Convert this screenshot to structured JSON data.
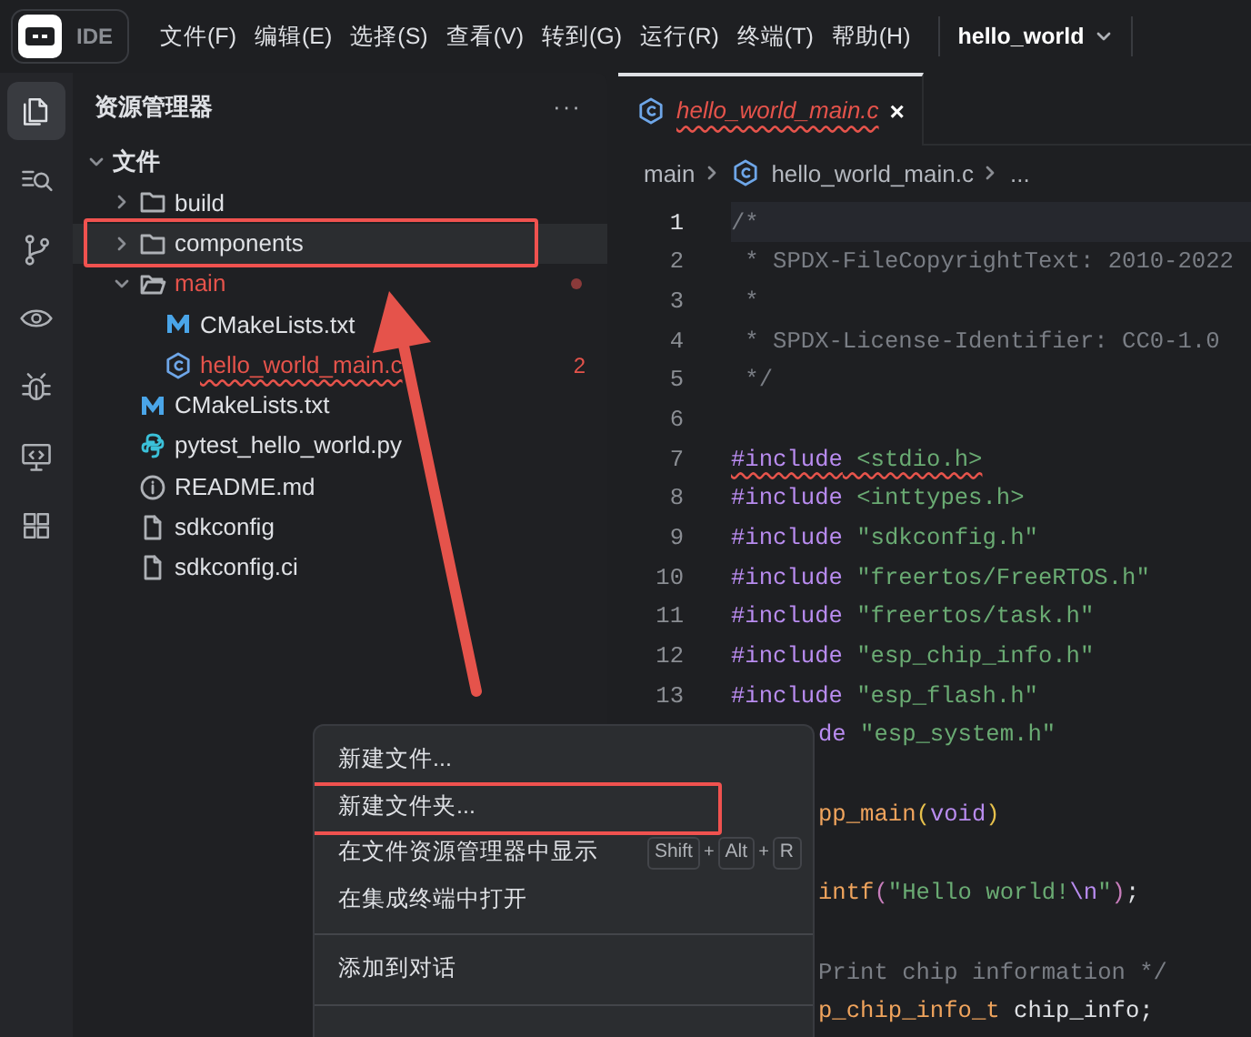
{
  "app": {
    "logo": "IDE",
    "menus": [
      "文件(F)",
      "编辑(E)",
      "选择(S)",
      "查看(V)",
      "转到(G)",
      "运行(R)",
      "终端(T)",
      "帮助(H)"
    ],
    "project": "hello_world"
  },
  "activity_bar": [
    {
      "kind": "files",
      "selected": true
    },
    {
      "kind": "search",
      "selected": false
    },
    {
      "kind": "branch",
      "selected": false
    },
    {
      "kind": "eye",
      "selected": false
    },
    {
      "kind": "bug",
      "selected": false
    },
    {
      "kind": "monitor",
      "selected": false
    },
    {
      "kind": "grid",
      "selected": false
    }
  ],
  "explorer": {
    "title": "资源管理器",
    "more": "···",
    "root": {
      "label": "文件",
      "expanded": true,
      "children": [
        {
          "label": "build",
          "kind": "folder",
          "expanded": false,
          "problem": false,
          "highlighted": false
        },
        {
          "label": "components",
          "kind": "folder",
          "expanded": false,
          "problem": false,
          "highlighted": true
        },
        {
          "label": "main",
          "kind": "folder",
          "expanded": true,
          "problem": true,
          "highlighted": false,
          "children": [
            {
              "label": "CMakeLists.txt",
              "kind": "cmake",
              "problem": false,
              "highlighted": false
            },
            {
              "label": "hello_world_main.c",
              "kind": "c",
              "problem": true,
              "problem_count": "2",
              "highlighted": false
            }
          ]
        },
        {
          "label": "CMakeLists.txt",
          "kind": "cmake",
          "problem": false,
          "highlighted": false
        },
        {
          "label": "pytest_hello_world.py",
          "kind": "python",
          "problem": false,
          "highlighted": false
        },
        {
          "label": "README.md",
          "kind": "info",
          "problem": false,
          "highlighted": false
        },
        {
          "label": "sdkconfig",
          "kind": "doc",
          "problem": false,
          "highlighted": false
        },
        {
          "label": "sdkconfig.ci",
          "kind": "doc",
          "problem": false,
          "highlighted": false
        }
      ]
    }
  },
  "editor": {
    "tabs": [
      {
        "label": "hello_world_main.c",
        "kind": "c",
        "problem": true,
        "selected": true,
        "close": "×"
      }
    ],
    "breadcrumb": [
      "main",
      "hello_world_main.c",
      "..."
    ],
    "lines": [
      {
        "number": "1",
        "current": true,
        "tokens": [
          {
            "kind": "comment",
            "text": "/*"
          }
        ]
      },
      {
        "number": "2",
        "current": false,
        "tokens": [
          {
            "kind": "comment",
            "text": " * SPDX-FileCopyrightText: 2010-2022"
          }
        ]
      },
      {
        "number": "3",
        "current": false,
        "tokens": [
          {
            "kind": "comment",
            "text": " *"
          }
        ]
      },
      {
        "number": "4",
        "current": false,
        "tokens": [
          {
            "kind": "comment",
            "text": " * SPDX-License-Identifier: CC0-1.0"
          }
        ]
      },
      {
        "number": "5",
        "current": false,
        "tokens": [
          {
            "kind": "comment",
            "text": " */"
          }
        ]
      },
      {
        "number": "6",
        "current": false
      },
      {
        "number": "7",
        "current": false,
        "tokens": [
          {
            "kind": "keyword",
            "text": "#include",
            "problem": true
          },
          {
            "kind": "string",
            "text": " <stdio.h>",
            "problem": true
          }
        ]
      },
      {
        "number": "8",
        "current": false,
        "tokens": [
          {
            "kind": "keyword",
            "text": "#include"
          },
          {
            "kind": "string",
            "text": " <inttypes.h>"
          }
        ]
      },
      {
        "number": "9",
        "current": false,
        "tokens": [
          {
            "kind": "keyword",
            "text": "#include"
          },
          {
            "kind": "string",
            "text": " \"sdkconfig.h\""
          }
        ]
      },
      {
        "number": "10",
        "current": false,
        "tokens": [
          {
            "kind": "keyword",
            "text": "#include"
          },
          {
            "kind": "string",
            "text": " \"freertos/FreeRTOS.h\""
          }
        ]
      },
      {
        "number": "11",
        "current": false,
        "tokens": [
          {
            "kind": "keyword",
            "text": "#include"
          },
          {
            "kind": "string",
            "text": " \"freertos/task.h\""
          }
        ]
      },
      {
        "number": "12",
        "current": false,
        "tokens": [
          {
            "kind": "keyword",
            "text": "#include"
          },
          {
            "kind": "string",
            "text": " \"esp_chip_info.h\""
          }
        ]
      },
      {
        "number": "13",
        "current": false,
        "tokens": [
          {
            "kind": "keyword",
            "text": "#include"
          },
          {
            "kind": "string",
            "text": " \"esp_flash.h\""
          }
        ]
      },
      {
        "kind": "partial",
        "tokens": [
          {
            "kind": "keyword",
            "text": "de"
          },
          {
            "kind": "string",
            "text": " \"esp_system.h\""
          }
        ]
      },
      {
        "kind": "partial"
      },
      {
        "kind": "partial",
        "tokens": [
          {
            "kind": "func",
            "text": "pp_main"
          },
          {
            "kind": "paren",
            "text": "("
          },
          {
            "kind": "keyword",
            "text": "void"
          },
          {
            "kind": "paren",
            "text": ")"
          }
        ]
      },
      {
        "kind": "partial"
      },
      {
        "kind": "partial",
        "tokens": [
          {
            "kind": "func",
            "text": "intf"
          },
          {
            "kind": "paren2",
            "text": "("
          },
          {
            "kind": "string",
            "text": "\"Hello world!"
          },
          {
            "kind": "keyword",
            "text": "\\n"
          },
          {
            "kind": "string",
            "text": "\""
          },
          {
            "kind": "paren2",
            "text": ")"
          },
          {
            "kind": "plain",
            "text": ";"
          }
        ]
      },
      {
        "kind": "partial"
      },
      {
        "kind": "partial",
        "tokens": [
          {
            "kind": "comment",
            "text": "Print chip information */"
          }
        ]
      },
      {
        "kind": "partial",
        "tokens": [
          {
            "kind": "func",
            "text": "p_chip_info_t"
          },
          {
            "kind": "plain",
            "text": " chip_info;"
          }
        ]
      }
    ]
  },
  "context_menu": {
    "groups": [
      [
        {
          "label": "新建文件...",
          "highlighted": false
        },
        {
          "label": "新建文件夹...",
          "highlighted": true
        },
        {
          "label": "在文件资源管理器中显示",
          "highlighted": false,
          "shortcut": [
            "Shift",
            "+",
            "Alt",
            "+",
            "R"
          ]
        },
        {
          "label": "在集成终端中打开",
          "highlighted": false
        }
      ],
      [
        {
          "label": "添加到对话",
          "highlighted": false
        }
      ]
    ],
    "more_below": true
  },
  "annotation_arrow": true
}
